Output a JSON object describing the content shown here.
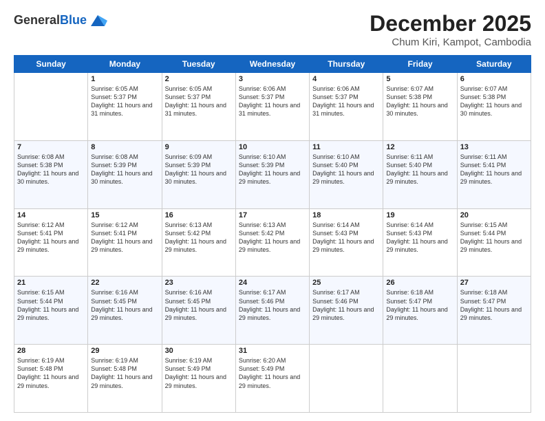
{
  "header": {
    "logo_line1": "General",
    "logo_line2": "Blue",
    "month": "December 2025",
    "location": "Chum Kiri, Kampot, Cambodia"
  },
  "days_of_week": [
    "Sunday",
    "Monday",
    "Tuesday",
    "Wednesday",
    "Thursday",
    "Friday",
    "Saturday"
  ],
  "weeks": [
    [
      {
        "day": "",
        "sunrise": "",
        "sunset": "",
        "daylight": "",
        "empty": true
      },
      {
        "day": "1",
        "sunrise": "6:05 AM",
        "sunset": "5:37 PM",
        "daylight": "11 hours and 31 minutes."
      },
      {
        "day": "2",
        "sunrise": "6:05 AM",
        "sunset": "5:37 PM",
        "daylight": "11 hours and 31 minutes."
      },
      {
        "day": "3",
        "sunrise": "6:06 AM",
        "sunset": "5:37 PM",
        "daylight": "11 hours and 31 minutes."
      },
      {
        "day": "4",
        "sunrise": "6:06 AM",
        "sunset": "5:37 PM",
        "daylight": "11 hours and 31 minutes."
      },
      {
        "day": "5",
        "sunrise": "6:07 AM",
        "sunset": "5:38 PM",
        "daylight": "11 hours and 30 minutes."
      },
      {
        "day": "6",
        "sunrise": "6:07 AM",
        "sunset": "5:38 PM",
        "daylight": "11 hours and 30 minutes."
      }
    ],
    [
      {
        "day": "7",
        "sunrise": "6:08 AM",
        "sunset": "5:38 PM",
        "daylight": "11 hours and 30 minutes."
      },
      {
        "day": "8",
        "sunrise": "6:08 AM",
        "sunset": "5:39 PM",
        "daylight": "11 hours and 30 minutes."
      },
      {
        "day": "9",
        "sunrise": "6:09 AM",
        "sunset": "5:39 PM",
        "daylight": "11 hours and 30 minutes."
      },
      {
        "day": "10",
        "sunrise": "6:10 AM",
        "sunset": "5:39 PM",
        "daylight": "11 hours and 29 minutes."
      },
      {
        "day": "11",
        "sunrise": "6:10 AM",
        "sunset": "5:40 PM",
        "daylight": "11 hours and 29 minutes."
      },
      {
        "day": "12",
        "sunrise": "6:11 AM",
        "sunset": "5:40 PM",
        "daylight": "11 hours and 29 minutes."
      },
      {
        "day": "13",
        "sunrise": "6:11 AM",
        "sunset": "5:41 PM",
        "daylight": "11 hours and 29 minutes."
      }
    ],
    [
      {
        "day": "14",
        "sunrise": "6:12 AM",
        "sunset": "5:41 PM",
        "daylight": "11 hours and 29 minutes."
      },
      {
        "day": "15",
        "sunrise": "6:12 AM",
        "sunset": "5:41 PM",
        "daylight": "11 hours and 29 minutes."
      },
      {
        "day": "16",
        "sunrise": "6:13 AM",
        "sunset": "5:42 PM",
        "daylight": "11 hours and 29 minutes."
      },
      {
        "day": "17",
        "sunrise": "6:13 AM",
        "sunset": "5:42 PM",
        "daylight": "11 hours and 29 minutes."
      },
      {
        "day": "18",
        "sunrise": "6:14 AM",
        "sunset": "5:43 PM",
        "daylight": "11 hours and 29 minutes."
      },
      {
        "day": "19",
        "sunrise": "6:14 AM",
        "sunset": "5:43 PM",
        "daylight": "11 hours and 29 minutes."
      },
      {
        "day": "20",
        "sunrise": "6:15 AM",
        "sunset": "5:44 PM",
        "daylight": "11 hours and 29 minutes."
      }
    ],
    [
      {
        "day": "21",
        "sunrise": "6:15 AM",
        "sunset": "5:44 PM",
        "daylight": "11 hours and 29 minutes."
      },
      {
        "day": "22",
        "sunrise": "6:16 AM",
        "sunset": "5:45 PM",
        "daylight": "11 hours and 29 minutes."
      },
      {
        "day": "23",
        "sunrise": "6:16 AM",
        "sunset": "5:45 PM",
        "daylight": "11 hours and 29 minutes."
      },
      {
        "day": "24",
        "sunrise": "6:17 AM",
        "sunset": "5:46 PM",
        "daylight": "11 hours and 29 minutes."
      },
      {
        "day": "25",
        "sunrise": "6:17 AM",
        "sunset": "5:46 PM",
        "daylight": "11 hours and 29 minutes."
      },
      {
        "day": "26",
        "sunrise": "6:18 AM",
        "sunset": "5:47 PM",
        "daylight": "11 hours and 29 minutes."
      },
      {
        "day": "27",
        "sunrise": "6:18 AM",
        "sunset": "5:47 PM",
        "daylight": "11 hours and 29 minutes."
      }
    ],
    [
      {
        "day": "28",
        "sunrise": "6:19 AM",
        "sunset": "5:48 PM",
        "daylight": "11 hours and 29 minutes."
      },
      {
        "day": "29",
        "sunrise": "6:19 AM",
        "sunset": "5:48 PM",
        "daylight": "11 hours and 29 minutes."
      },
      {
        "day": "30",
        "sunrise": "6:19 AM",
        "sunset": "5:49 PM",
        "daylight": "11 hours and 29 minutes."
      },
      {
        "day": "31",
        "sunrise": "6:20 AM",
        "sunset": "5:49 PM",
        "daylight": "11 hours and 29 minutes."
      },
      {
        "day": "",
        "sunrise": "",
        "sunset": "",
        "daylight": "",
        "empty": true
      },
      {
        "day": "",
        "sunrise": "",
        "sunset": "",
        "daylight": "",
        "empty": true
      },
      {
        "day": "",
        "sunrise": "",
        "sunset": "",
        "daylight": "",
        "empty": true
      }
    ]
  ],
  "labels": {
    "sunrise": "Sunrise:",
    "sunset": "Sunset:",
    "daylight": "Daylight:"
  }
}
